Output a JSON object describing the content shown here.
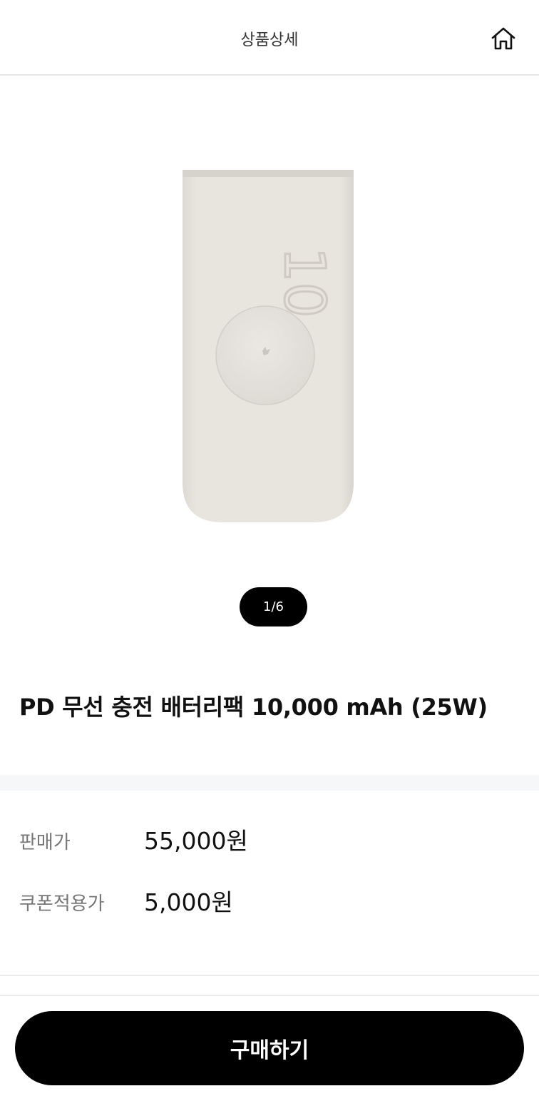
{
  "header": {
    "title": "상품상세",
    "home_icon": "home-icon"
  },
  "gallery": {
    "pager": "1/6",
    "product_print": "10"
  },
  "product": {
    "title": "PD 무선 충전 배터리팩 10,000 mAh (25W)"
  },
  "pricing": {
    "sale_label": "판매가",
    "sale_value": "55,000원",
    "coupon_label": "쿠폰적용가",
    "coupon_value": "5,000원"
  },
  "footer": {
    "buy_label": "구매하기"
  },
  "colors": {
    "button_bg": "#000000",
    "product_color": "#e6e2dc"
  }
}
